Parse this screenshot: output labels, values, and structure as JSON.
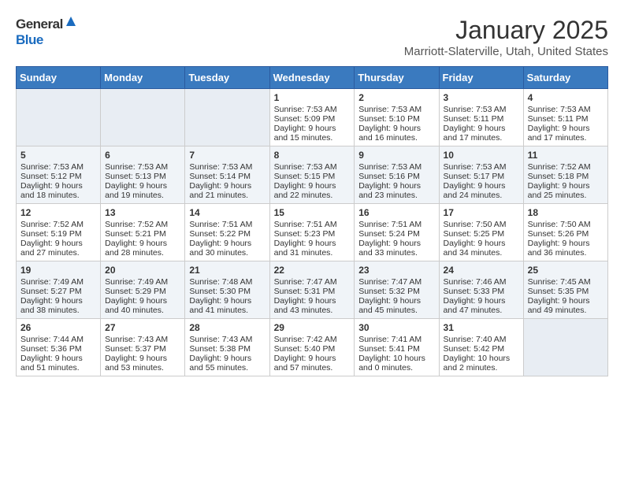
{
  "header": {
    "logo_general": "General",
    "logo_blue": "Blue",
    "month_title": "January 2025",
    "location": "Marriott-Slaterville, Utah, United States"
  },
  "weekdays": [
    "Sunday",
    "Monday",
    "Tuesday",
    "Wednesday",
    "Thursday",
    "Friday",
    "Saturday"
  ],
  "weeks": [
    [
      {
        "day": "",
        "content": ""
      },
      {
        "day": "",
        "content": ""
      },
      {
        "day": "",
        "content": ""
      },
      {
        "day": "1",
        "content": "Sunrise: 7:53 AM\nSunset: 5:09 PM\nDaylight: 9 hours\nand 15 minutes."
      },
      {
        "day": "2",
        "content": "Sunrise: 7:53 AM\nSunset: 5:10 PM\nDaylight: 9 hours\nand 16 minutes."
      },
      {
        "day": "3",
        "content": "Sunrise: 7:53 AM\nSunset: 5:11 PM\nDaylight: 9 hours\nand 17 minutes."
      },
      {
        "day": "4",
        "content": "Sunrise: 7:53 AM\nSunset: 5:11 PM\nDaylight: 9 hours\nand 17 minutes."
      }
    ],
    [
      {
        "day": "5",
        "content": "Sunrise: 7:53 AM\nSunset: 5:12 PM\nDaylight: 9 hours\nand 18 minutes."
      },
      {
        "day": "6",
        "content": "Sunrise: 7:53 AM\nSunset: 5:13 PM\nDaylight: 9 hours\nand 19 minutes."
      },
      {
        "day": "7",
        "content": "Sunrise: 7:53 AM\nSunset: 5:14 PM\nDaylight: 9 hours\nand 21 minutes."
      },
      {
        "day": "8",
        "content": "Sunrise: 7:53 AM\nSunset: 5:15 PM\nDaylight: 9 hours\nand 22 minutes."
      },
      {
        "day": "9",
        "content": "Sunrise: 7:53 AM\nSunset: 5:16 PM\nDaylight: 9 hours\nand 23 minutes."
      },
      {
        "day": "10",
        "content": "Sunrise: 7:53 AM\nSunset: 5:17 PM\nDaylight: 9 hours\nand 24 minutes."
      },
      {
        "day": "11",
        "content": "Sunrise: 7:52 AM\nSunset: 5:18 PM\nDaylight: 9 hours\nand 25 minutes."
      }
    ],
    [
      {
        "day": "12",
        "content": "Sunrise: 7:52 AM\nSunset: 5:19 PM\nDaylight: 9 hours\nand 27 minutes."
      },
      {
        "day": "13",
        "content": "Sunrise: 7:52 AM\nSunset: 5:21 PM\nDaylight: 9 hours\nand 28 minutes."
      },
      {
        "day": "14",
        "content": "Sunrise: 7:51 AM\nSunset: 5:22 PM\nDaylight: 9 hours\nand 30 minutes."
      },
      {
        "day": "15",
        "content": "Sunrise: 7:51 AM\nSunset: 5:23 PM\nDaylight: 9 hours\nand 31 minutes."
      },
      {
        "day": "16",
        "content": "Sunrise: 7:51 AM\nSunset: 5:24 PM\nDaylight: 9 hours\nand 33 minutes."
      },
      {
        "day": "17",
        "content": "Sunrise: 7:50 AM\nSunset: 5:25 PM\nDaylight: 9 hours\nand 34 minutes."
      },
      {
        "day": "18",
        "content": "Sunrise: 7:50 AM\nSunset: 5:26 PM\nDaylight: 9 hours\nand 36 minutes."
      }
    ],
    [
      {
        "day": "19",
        "content": "Sunrise: 7:49 AM\nSunset: 5:27 PM\nDaylight: 9 hours\nand 38 minutes."
      },
      {
        "day": "20",
        "content": "Sunrise: 7:49 AM\nSunset: 5:29 PM\nDaylight: 9 hours\nand 40 minutes."
      },
      {
        "day": "21",
        "content": "Sunrise: 7:48 AM\nSunset: 5:30 PM\nDaylight: 9 hours\nand 41 minutes."
      },
      {
        "day": "22",
        "content": "Sunrise: 7:47 AM\nSunset: 5:31 PM\nDaylight: 9 hours\nand 43 minutes."
      },
      {
        "day": "23",
        "content": "Sunrise: 7:47 AM\nSunset: 5:32 PM\nDaylight: 9 hours\nand 45 minutes."
      },
      {
        "day": "24",
        "content": "Sunrise: 7:46 AM\nSunset: 5:33 PM\nDaylight: 9 hours\nand 47 minutes."
      },
      {
        "day": "25",
        "content": "Sunrise: 7:45 AM\nSunset: 5:35 PM\nDaylight: 9 hours\nand 49 minutes."
      }
    ],
    [
      {
        "day": "26",
        "content": "Sunrise: 7:44 AM\nSunset: 5:36 PM\nDaylight: 9 hours\nand 51 minutes."
      },
      {
        "day": "27",
        "content": "Sunrise: 7:43 AM\nSunset: 5:37 PM\nDaylight: 9 hours\nand 53 minutes."
      },
      {
        "day": "28",
        "content": "Sunrise: 7:43 AM\nSunset: 5:38 PM\nDaylight: 9 hours\nand 55 minutes."
      },
      {
        "day": "29",
        "content": "Sunrise: 7:42 AM\nSunset: 5:40 PM\nDaylight: 9 hours\nand 57 minutes."
      },
      {
        "day": "30",
        "content": "Sunrise: 7:41 AM\nSunset: 5:41 PM\nDaylight: 10 hours\nand 0 minutes."
      },
      {
        "day": "31",
        "content": "Sunrise: 7:40 AM\nSunset: 5:42 PM\nDaylight: 10 hours\nand 2 minutes."
      },
      {
        "day": "",
        "content": ""
      }
    ]
  ]
}
